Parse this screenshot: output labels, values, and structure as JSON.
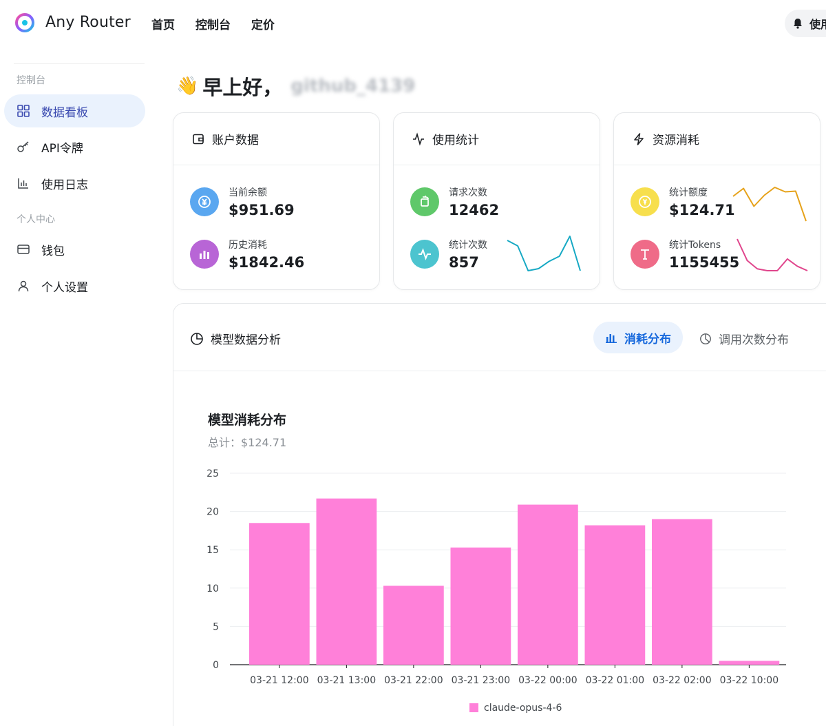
{
  "app": {
    "brand": "Any Router",
    "nav": [
      "首页",
      "控制台",
      "定价"
    ],
    "top_right_label": "使用"
  },
  "sidebar": {
    "group1": "控制台",
    "items": [
      {
        "label": "数据看板",
        "icon": "dashboard-grid-icon",
        "active": true
      },
      {
        "label": "API令牌",
        "icon": "key-icon"
      },
      {
        "label": "使用日志",
        "icon": "bar-log-icon"
      }
    ],
    "group2": "个人中心",
    "items2": [
      {
        "label": "钱包",
        "icon": "wallet-card-icon"
      },
      {
        "label": "个人设置",
        "icon": "user-icon"
      }
    ]
  },
  "greeting": {
    "text": "早上好，",
    "username": "github_4139"
  },
  "cards": {
    "account": {
      "title": "账户数据",
      "balance_label": "当前余额",
      "balance_value": "$951.69",
      "spent_label": "历史消耗",
      "spent_value": "$1842.46"
    },
    "usage": {
      "title": "使用统计",
      "requests_label": "请求次数",
      "requests_value": "12462",
      "count_label": "统计次数",
      "count_value": "857",
      "spark": [
        0.88,
        0.72,
        0.0,
        0.06,
        0.27,
        0.42,
        1.0,
        0.0
      ]
    },
    "resource": {
      "title": "资源消耗",
      "quota_label": "统计额度",
      "quota_value": "$124.71",
      "quota_spark": [
        0.72,
        0.95,
        0.43,
        0.75,
        0.98,
        0.85,
        0.87,
        0.0
      ],
      "tokens_label": "统计Tokens",
      "tokens_value": "1155455",
      "tokens_spark": [
        1.0,
        0.32,
        0.06,
        0.0,
        0.0,
        0.37,
        0.14,
        0.0
      ]
    }
  },
  "analysis": {
    "title": "模型数据分析",
    "tab_active": "消耗分布",
    "tab_inactive": "调用次数分布"
  },
  "chart_data": {
    "type": "bar",
    "title": "模型消耗分布",
    "subtitle": "总计：$124.71",
    "categories": [
      "03-21 12:00",
      "03-21 13:00",
      "03-21 22:00",
      "03-21 23:00",
      "03-22 00:00",
      "03-22 01:00",
      "03-22 02:00",
      "03-22 10:00"
    ],
    "series": [
      {
        "name": "claude-opus-4-6",
        "values": [
          18.5,
          21.7,
          10.3,
          15.3,
          20.9,
          18.2,
          19.0,
          0.5
        ],
        "color": "#ff80d9"
      }
    ],
    "ylim": [
      0,
      25
    ],
    "yticks": [
      0,
      5,
      10,
      15,
      20,
      25
    ],
    "grid": true,
    "legend": "bottom"
  },
  "colors": {
    "accent": "#1668dc",
    "bar": "#ff80d9",
    "usage_spark": "#17a9c4",
    "quota_spark": "#e6a21a",
    "tokens_spark": "#e0458c"
  }
}
